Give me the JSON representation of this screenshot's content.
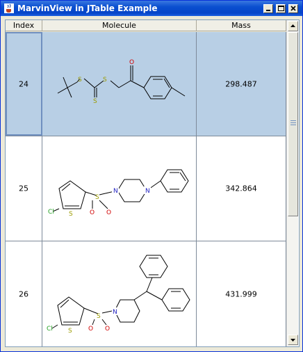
{
  "window": {
    "title": "MarvinView in JTable Example",
    "icon": "java-cup-icon",
    "controls": [
      "minimize",
      "maximize",
      "close"
    ]
  },
  "table": {
    "columns": [
      "Index",
      "Molecule",
      "Mass"
    ],
    "rows": [
      {
        "index": "24",
        "mass": "298.487",
        "selected": true
      },
      {
        "index": "25",
        "mass": "342.864",
        "selected": false
      },
      {
        "index": "26",
        "mass": "431.999",
        "selected": false
      }
    ],
    "molecule_atom_labels": {
      "row24": [
        "S",
        "S",
        "S",
        "O"
      ],
      "row25": [
        "Cl",
        "S",
        "S",
        "O",
        "O",
        "N",
        "N"
      ],
      "row26": [
        "Cl",
        "S",
        "S",
        "O",
        "O",
        "N"
      ]
    }
  },
  "colors": {
    "selection": "#b8cfe5",
    "sulfur": "#9b9b00",
    "oxygen": "#d00000",
    "nitrogen": "#2020c0",
    "chlorine": "#20a020"
  }
}
